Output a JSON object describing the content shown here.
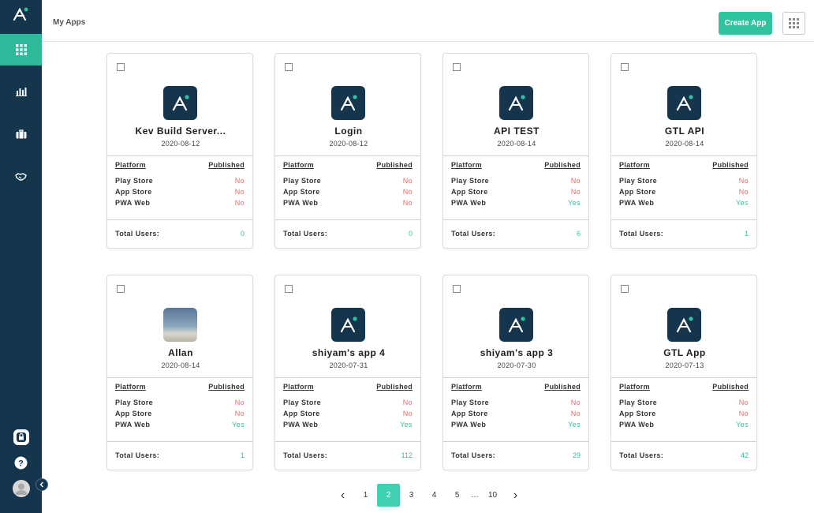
{
  "header": {
    "title": "My Apps",
    "create_label": "Create App"
  },
  "sidebar": {
    "items": [
      {
        "icon": "apps-grid-icon",
        "active": true
      },
      {
        "icon": "bar-chart-icon",
        "active": false
      },
      {
        "icon": "briefcase-icon",
        "active": false
      },
      {
        "icon": "handshake-icon",
        "active": false
      }
    ],
    "bottom": [
      "lock-icon",
      "help-icon",
      "avatar"
    ]
  },
  "table_headers": {
    "platform": "Platform",
    "published": "Published"
  },
  "platform_labels": [
    "Play Store",
    "App Store",
    "PWA Web"
  ],
  "total_users_label": "Total Users:",
  "apps": [
    {
      "name": "Kev Build Server...",
      "date": "2020-08-12",
      "icon": "logo",
      "play": "No",
      "app": "No",
      "pwa": "No",
      "users": "0"
    },
    {
      "name": "Login",
      "date": "2020-08-12",
      "icon": "logo",
      "play": "No",
      "app": "No",
      "pwa": "No",
      "users": "0"
    },
    {
      "name": "API TEST",
      "date": "2020-08-14",
      "icon": "logo",
      "play": "No",
      "app": "No",
      "pwa": "Yes",
      "users": "6"
    },
    {
      "name": "GTL API",
      "date": "2020-08-14",
      "icon": "logo",
      "play": "No",
      "app": "No",
      "pwa": "Yes",
      "users": "1"
    },
    {
      "name": "Allan",
      "date": "2020-08-14",
      "icon": "photo",
      "play": "No",
      "app": "No",
      "pwa": "Yes",
      "users": "1"
    },
    {
      "name": "shiyam's app 4",
      "date": "2020-07-31",
      "icon": "logo",
      "play": "No",
      "app": "No",
      "pwa": "Yes",
      "users": "112"
    },
    {
      "name": "shiyam's app 3",
      "date": "2020-07-30",
      "icon": "logo",
      "play": "No",
      "app": "No",
      "pwa": "Yes",
      "users": "29"
    },
    {
      "name": "GTL App",
      "date": "2020-07-13",
      "icon": "logo",
      "play": "No",
      "app": "No",
      "pwa": "Yes",
      "users": "42"
    }
  ],
  "pagination": {
    "prev": "‹",
    "next": "›",
    "pages": [
      "1",
      "2",
      "3",
      "4",
      "5",
      "…",
      "10"
    ],
    "current": "2"
  },
  "colors": {
    "sidebar": "#14354b",
    "accent": "#2ec4a0",
    "no": "#e26b6b",
    "yes": "#2ec4a0"
  }
}
